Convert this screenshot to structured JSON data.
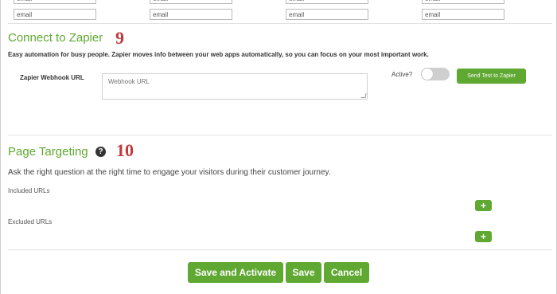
{
  "email_mapping": {
    "fields": [
      "email",
      "email",
      "email",
      "email"
    ],
    "cut_fields": [
      "email",
      "email",
      "email",
      "email"
    ]
  },
  "zapier": {
    "title": "Connect to Zapier",
    "step_number": "9",
    "description": "Easy automation for busy people. Zapier moves info between your web apps automatically, so you can focus on your most important work.",
    "webhook_label": "Zapier Webhook URL",
    "webhook_placeholder": "Webhook URL",
    "webhook_value": "",
    "active_label": "Active?",
    "active": false,
    "send_test_label": "Send Test to Zapier"
  },
  "page_targeting": {
    "title": "Page Targeting",
    "help_icon": "question-circle-icon",
    "step_number": "10",
    "description": "Ask the right question at the right time to engage your visitors during their customer journey.",
    "included_label": "Included URLs",
    "excluded_label": "Excluded URLs",
    "add_label": "+"
  },
  "actions": {
    "save_activate_label": "Save and Activate",
    "save_label": "Save",
    "cancel_label": "Cancel"
  },
  "colors": {
    "accent_green": "#5fa832",
    "step_red": "#c0393b",
    "toggle_off": "#cfcfcf"
  }
}
